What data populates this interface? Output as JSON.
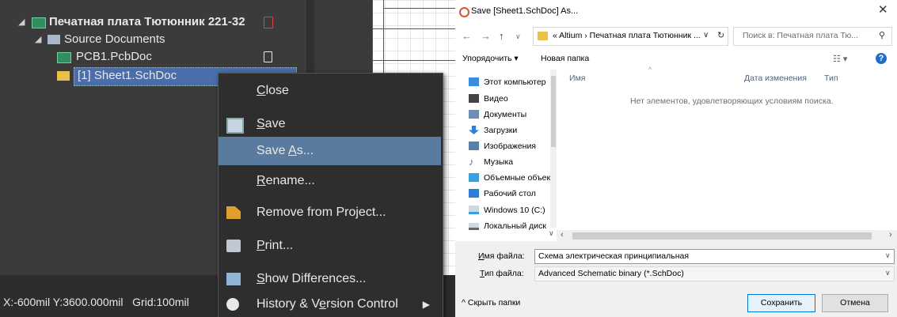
{
  "project_tree": {
    "project_label": "Печатная плата Тютюнник 221-32",
    "folder_label": "Source Documents",
    "pcb_doc": "PCB1.PcbDoc",
    "sch_doc": "[1] Sheet1.SchDoc"
  },
  "status_bar": {
    "coords": "X:-600mil Y:3600.000mil",
    "grid": "Grid:100mil"
  },
  "context_menu": {
    "items": [
      {
        "label_pre": "",
        "label_u": "C",
        "label_post": "lose"
      },
      {
        "label_pre": "",
        "label_u": "S",
        "label_post": "ave"
      },
      {
        "label_pre": "Save ",
        "label_u": "A",
        "label_post": "s..."
      },
      {
        "label_pre": "",
        "label_u": "R",
        "label_post": "ename..."
      },
      {
        "label_pre": "Remove from Project...",
        "label_u": "",
        "label_post": ""
      },
      {
        "label_pre": "",
        "label_u": "P",
        "label_post": "rint..."
      },
      {
        "label_pre": "",
        "label_u": "S",
        "label_post": "how Differences..."
      },
      {
        "label_pre": "History & V",
        "label_u": "e",
        "label_post": "rsion Control"
      }
    ],
    "selected_index": 2
  },
  "dialog": {
    "title": "Save [Sheet1.SchDoc] As...",
    "close": "✕",
    "nav": {
      "back": "←",
      "forward": "→",
      "up": "↑"
    },
    "address": "« Altium › Печатная плата Тютюнник ...",
    "search_placeholder": "Поиск в: Печатная плата Тю...",
    "organize": "Упорядочить ▾",
    "new_folder": "Новая папка",
    "nav_pane": [
      {
        "label": "Этот компьютер",
        "icon": "computer-icon",
        "color": "#3c8de0"
      },
      {
        "label": "Видео",
        "icon": "video-icon",
        "color": "#444"
      },
      {
        "label": "Документы",
        "icon": "documents-icon",
        "color": "#6b8fb8"
      },
      {
        "label": "Загрузки",
        "icon": "downloads-icon",
        "color": "#2d7fd6"
      },
      {
        "label": "Изображения",
        "icon": "images-icon",
        "color": "#5a7fa8"
      },
      {
        "label": "Музыка",
        "icon": "music-icon",
        "color": "#2d7fd6"
      },
      {
        "label": "Объемные объекты",
        "icon": "3d-objects-icon",
        "color": "#3aa0e0"
      },
      {
        "label": "Рабочий стол",
        "icon": "desktop-icon",
        "color": "#2d7fd6"
      },
      {
        "label": "Windows 10 (C:)",
        "icon": "drive-c-icon",
        "color": "#3aa0e0"
      },
      {
        "label": "Локальный диск",
        "icon": "drive-icon",
        "color": "#666"
      }
    ],
    "columns": {
      "name": "Имя",
      "date": "Дата изменения",
      "type": "Тип"
    },
    "empty_message": "Нет элементов, удовлетворяющих условиям поиска.",
    "file_name_label_u": "И",
    "file_name_label_rest": "мя файла:",
    "file_name_value": "Схема электрическая принципиальная",
    "file_type_label_u": "Т",
    "file_type_label_rest": "ип файла:",
    "file_type_value": "Advanced Schematic binary (*.SchDoc)",
    "hide_folders": "Скрыть папки",
    "save_button": "Сохранить",
    "cancel_button": "Отмена"
  },
  "colors": {
    "menu_highlight": "#5a7ba0",
    "dark_bg": "#3b3b3b",
    "selection": "#4a6ea9",
    "dialog_accent": "#0078d7"
  }
}
